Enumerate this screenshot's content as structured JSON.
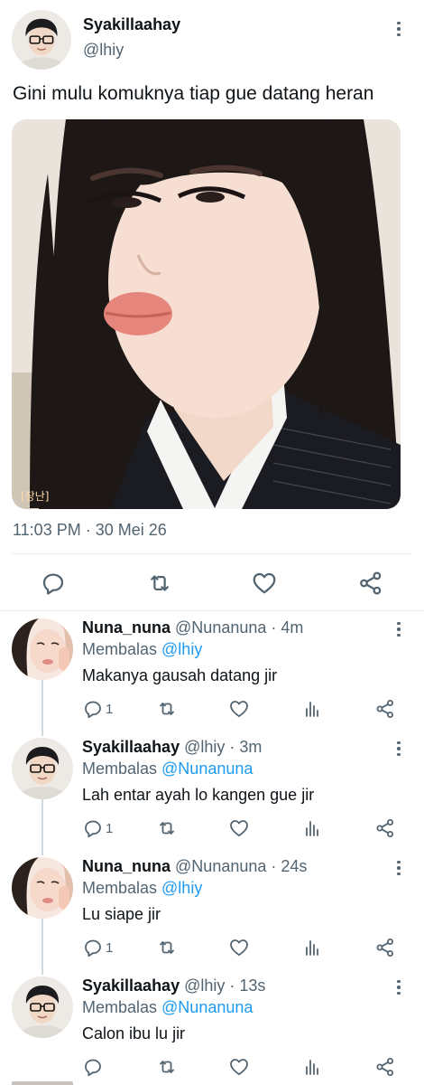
{
  "tweet": {
    "author_name": "Syakillaahay",
    "author_handle": "@lhiy",
    "text": "Gini mulu komuknya tiap gue datang heran",
    "photo_tag": "[장난]",
    "timestamp": "11:03 PM · 30 Mei 26"
  },
  "icons": {
    "reply": "reply-icon",
    "retweet": "retweet-icon",
    "like": "heart-icon",
    "share": "share-icon",
    "analytics": "analytics-icon",
    "more": "more-icon"
  },
  "replies": [
    {
      "name": "Nuna_nuna",
      "meta": "@Nunanuna · 4m",
      "replying_prefix": "Membalas ",
      "replying_to": "@lhiy",
      "text": "Makanya gausah datang jir",
      "reply_count": "1"
    },
    {
      "name": "Syakillaahay",
      "meta": "@lhiy · 3m",
      "replying_prefix": "Membalas ",
      "replying_to": "@Nunanuna",
      "text": "Lah entar ayah lo kangen gue jir",
      "reply_count": "1"
    },
    {
      "name": "Nuna_nuna",
      "meta": "@Nunanuna · 24s",
      "replying_prefix": "Membalas ",
      "replying_to": "@lhiy",
      "text": "Lu siape jir",
      "reply_count": "1"
    },
    {
      "name": "Syakillaahay",
      "meta": "@lhiy · 13s",
      "replying_prefix": "Membalas ",
      "replying_to": "@Nunanuna",
      "text": "Calon ibu lu jir",
      "reply_count": ""
    }
  ],
  "colors": {
    "text": "#0f1419",
    "secondary": "#536471",
    "link": "#1d9bf0",
    "divider": "#e6ecf0"
  }
}
